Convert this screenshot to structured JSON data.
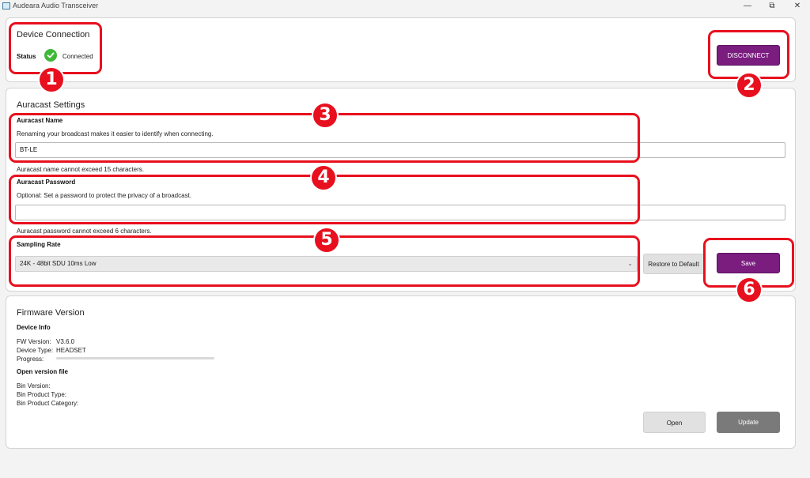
{
  "window": {
    "title": "Audeara Audio Transceiver",
    "min_glyph": "—",
    "max_glyph": "⧉",
    "close_glyph": "✕"
  },
  "connection": {
    "heading": "Device Connection",
    "status_label": "Status",
    "status_value": "Connected",
    "disconnect_label": "DISCONNECT"
  },
  "auracast": {
    "heading": "Auracast Settings",
    "name": {
      "label": "Auracast Name",
      "description": "Renaming your broadcast makes it easier to identify when connecting.",
      "value": "BT-LE",
      "hint": "Auracast name cannot exceed 15 characters."
    },
    "password": {
      "label": "Auracast Password",
      "description": "Optional: Set a password to protect the privacy of a broadcast.",
      "value": "",
      "hint": "Auracast password cannot exceed 6 characters."
    },
    "sampling": {
      "label": "Sampling Rate",
      "selected": "24K - 48bit SDU 10ms Low",
      "chevron": "⌄"
    },
    "restore_label": "Restore to Default",
    "save_label": "Save"
  },
  "firmware": {
    "heading": "Firmware Version",
    "device_info_label": "Device Info",
    "fw_version_label": "FW Version:",
    "fw_version_value": "V3.6.0",
    "device_type_label": "Device Type:",
    "device_type_value": "HEADSET",
    "progress_label": "Progress:",
    "progress_value": 0,
    "open_file_label": "Open version file",
    "bin_version_label": "Bin Version:",
    "bin_product_type_label": "Bin Product Type:",
    "bin_product_category_label": "Bin Product Category:",
    "open_label": "Open",
    "update_label": "Update"
  },
  "annotations": {
    "color": "#e8101e",
    "numbers": [
      "1",
      "2",
      "3",
      "4",
      "5",
      "6"
    ]
  }
}
